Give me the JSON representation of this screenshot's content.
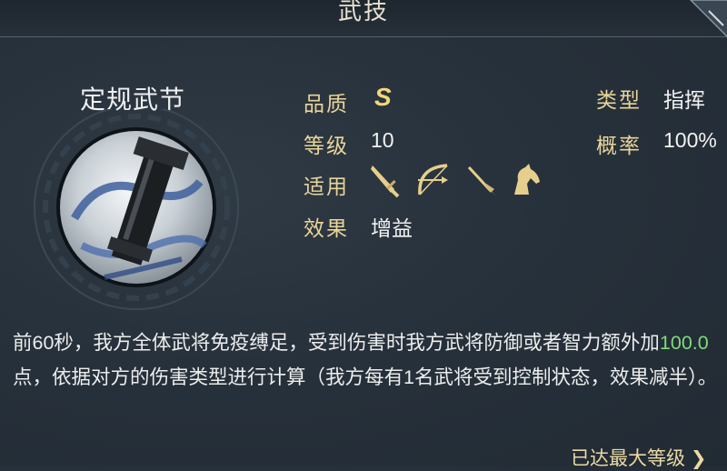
{
  "header": {
    "title": "武技"
  },
  "skill": {
    "name": "定规武节",
    "quality_label": "品质",
    "quality_value": "S",
    "level_label": "等级",
    "level_value": "10",
    "applies_label": "适用",
    "applies_units": [
      "sword-icon",
      "bow-icon",
      "spear-icon",
      "horse-icon"
    ],
    "effect_label": "效果",
    "effect_value": "增益",
    "type_label": "类型",
    "type_value": "指挥",
    "rate_label": "概率",
    "rate_value": "100%"
  },
  "description": {
    "part1": "前60秒，我方全体武将免疫缚足，受到伤害时我方武将防御或者智力额外加",
    "highlight": "100.0",
    "part2": "点，依据对方的伤害类型进行计算（我方每有1名武将受到控制状态，效果减半）。"
  },
  "footer": {
    "max_level_text": "已达最大等级"
  },
  "colors": {
    "label_gold": "#e9d59a",
    "highlight_green": "#7fdb7a",
    "background": "#27313b"
  }
}
